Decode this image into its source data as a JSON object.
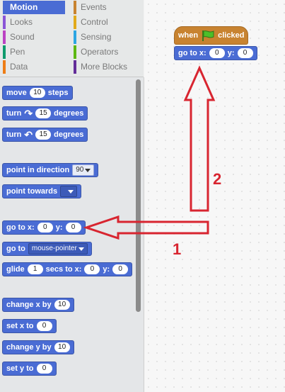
{
  "categories": [
    {
      "label": "Motion",
      "color": "#4a6cd4",
      "selected": true
    },
    {
      "label": "Events",
      "color": "#c88330",
      "selected": false
    },
    {
      "label": "Looks",
      "color": "#8a55d7",
      "selected": false
    },
    {
      "label": "Control",
      "color": "#e1a91a",
      "selected": false
    },
    {
      "label": "Sound",
      "color": "#bb42c3",
      "selected": false
    },
    {
      "label": "Sensing",
      "color": "#2ca5e2",
      "selected": false
    },
    {
      "label": "Pen",
      "color": "#0e9a6c",
      "selected": false
    },
    {
      "label": "Operators",
      "color": "#5cb712",
      "selected": false
    },
    {
      "label": "Data",
      "color": "#ee7d16",
      "selected": false
    },
    {
      "label": "More Blocks",
      "color": "#632d99",
      "selected": false
    }
  ],
  "palette": {
    "move": {
      "pre": "move",
      "val": "10",
      "post": "steps"
    },
    "turn_right": {
      "pre": "turn",
      "icon": "↷",
      "val": "15",
      "post": "degrees"
    },
    "turn_left": {
      "pre": "turn",
      "icon": "↶",
      "val": "15",
      "post": "degrees"
    },
    "point_dir": {
      "pre": "point in direction",
      "val": "90"
    },
    "point_towards": {
      "pre": "point towards"
    },
    "goto_xy": {
      "pre": "go to x:",
      "x": "0",
      "mid": "y:",
      "y": "0"
    },
    "goto": {
      "pre": "go to",
      "val": "mouse-pointer"
    },
    "glide": {
      "pre": "glide",
      "secs": "1",
      "mid": "secs to x:",
      "x": "0",
      "mid2": "y:",
      "y": "0"
    },
    "change_x": {
      "pre": "change x by",
      "val": "10"
    },
    "set_x": {
      "pre": "set x to",
      "val": "0"
    },
    "change_y": {
      "pre": "change y by",
      "val": "10"
    },
    "set_y": {
      "pre": "set y to",
      "val": "0"
    }
  },
  "script": {
    "hat": {
      "pre": "when",
      "post": "clicked"
    },
    "goto_xy": {
      "pre": "go to x:",
      "x": "0",
      "mid": "y:",
      "y": "0"
    }
  },
  "annotations": {
    "label1": "1",
    "label2": "2",
    "arrow_color": "#d82530"
  }
}
